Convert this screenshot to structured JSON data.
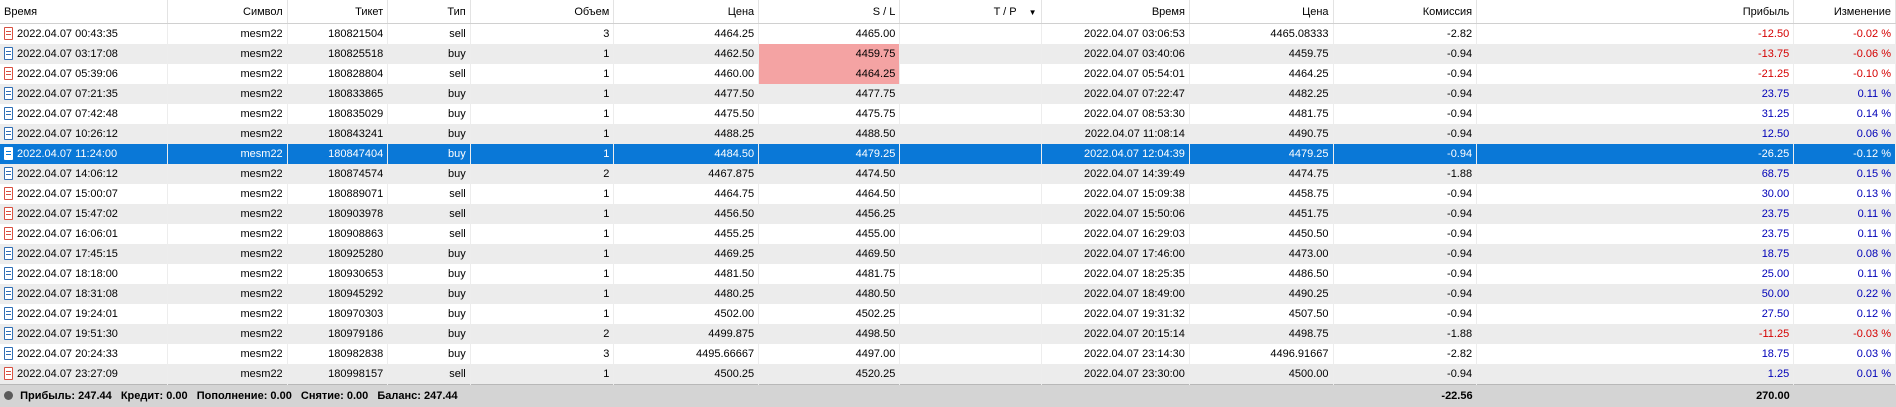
{
  "columns": {
    "time": "Время",
    "symbol": "Символ",
    "ticket": "Тикет",
    "type": "Тип",
    "volume": "Объем",
    "price": "Цена",
    "sl": "S / L",
    "tp": "T / P",
    "close_time": "Время",
    "close_price": "Цена",
    "commission": "Комиссия",
    "profit": "Прибыль",
    "change": "Изменение"
  },
  "sort_arrow": "▼",
  "rows": [
    {
      "time": "2022.04.07 00:43:35",
      "symbol": "mesm22",
      "ticket": "180821504",
      "type": "sell",
      "volume": "3",
      "price": "4464.25",
      "sl": "4465.00",
      "tp": "",
      "close_time": "2022.04.07 03:06:53",
      "close_price": "4465.08333",
      "commission": "-2.82",
      "profit": "-12.50",
      "change": "-0.02 %"
    },
    {
      "time": "2022.04.07 03:17:08",
      "symbol": "mesm22",
      "ticket": "180825518",
      "type": "buy",
      "volume": "1",
      "price": "4462.50",
      "sl": "4459.75",
      "tp": "",
      "close_time": "2022.04.07 03:40:06",
      "close_price": "4459.75",
      "commission": "-0.94",
      "profit": "-13.75",
      "change": "-0.06 %"
    },
    {
      "time": "2022.04.07 05:39:06",
      "symbol": "mesm22",
      "ticket": "180828804",
      "type": "sell",
      "volume": "1",
      "price": "4460.00",
      "sl": "4464.25",
      "tp": "",
      "close_time": "2022.04.07 05:54:01",
      "close_price": "4464.25",
      "commission": "-0.94",
      "profit": "-21.25",
      "change": "-0.10 %"
    },
    {
      "time": "2022.04.07 07:21:35",
      "symbol": "mesm22",
      "ticket": "180833865",
      "type": "buy",
      "volume": "1",
      "price": "4477.50",
      "sl": "4477.75",
      "tp": "",
      "close_time": "2022.04.07 07:22:47",
      "close_price": "4482.25",
      "commission": "-0.94",
      "profit": "23.75",
      "change": "0.11 %"
    },
    {
      "time": "2022.04.07 07:42:48",
      "symbol": "mesm22",
      "ticket": "180835029",
      "type": "buy",
      "volume": "1",
      "price": "4475.50",
      "sl": "4475.75",
      "tp": "",
      "close_time": "2022.04.07 08:53:30",
      "close_price": "4481.75",
      "commission": "-0.94",
      "profit": "31.25",
      "change": "0.14 %"
    },
    {
      "time": "2022.04.07 10:26:12",
      "symbol": "mesm22",
      "ticket": "180843241",
      "type": "buy",
      "volume": "1",
      "price": "4488.25",
      "sl": "4488.50",
      "tp": "",
      "close_time": "2022.04.07 11:08:14",
      "close_price": "4490.75",
      "commission": "-0.94",
      "profit": "12.50",
      "change": "0.06 %"
    },
    {
      "time": "2022.04.07 11:24:00",
      "symbol": "mesm22",
      "ticket": "180847404",
      "type": "buy",
      "volume": "1",
      "price": "4484.50",
      "sl": "4479.25",
      "tp": "",
      "close_time": "2022.04.07 12:04:39",
      "close_price": "4479.25",
      "commission": "-0.94",
      "profit": "-26.25",
      "change": "-0.12 %"
    },
    {
      "time": "2022.04.07 14:06:12",
      "symbol": "mesm22",
      "ticket": "180874574",
      "type": "buy",
      "volume": "2",
      "price": "4467.875",
      "sl": "4474.50",
      "tp": "",
      "close_time": "2022.04.07 14:39:49",
      "close_price": "4474.75",
      "commission": "-1.88",
      "profit": "68.75",
      "change": "0.15 %"
    },
    {
      "time": "2022.04.07 15:00:07",
      "symbol": "mesm22",
      "ticket": "180889071",
      "type": "sell",
      "volume": "1",
      "price": "4464.75",
      "sl": "4464.50",
      "tp": "",
      "close_time": "2022.04.07 15:09:38",
      "close_price": "4458.75",
      "commission": "-0.94",
      "profit": "30.00",
      "change": "0.13 %"
    },
    {
      "time": "2022.04.07 15:47:02",
      "symbol": "mesm22",
      "ticket": "180903978",
      "type": "sell",
      "volume": "1",
      "price": "4456.50",
      "sl": "4456.25",
      "tp": "",
      "close_time": "2022.04.07 15:50:06",
      "close_price": "4451.75",
      "commission": "-0.94",
      "profit": "23.75",
      "change": "0.11 %"
    },
    {
      "time": "2022.04.07 16:06:01",
      "symbol": "mesm22",
      "ticket": "180908863",
      "type": "sell",
      "volume": "1",
      "price": "4455.25",
      "sl": "4455.00",
      "tp": "",
      "close_time": "2022.04.07 16:29:03",
      "close_price": "4450.50",
      "commission": "-0.94",
      "profit": "23.75",
      "change": "0.11 %"
    },
    {
      "time": "2022.04.07 17:45:15",
      "symbol": "mesm22",
      "ticket": "180925280",
      "type": "buy",
      "volume": "1",
      "price": "4469.25",
      "sl": "4469.50",
      "tp": "",
      "close_time": "2022.04.07 17:46:00",
      "close_price": "4473.00",
      "commission": "-0.94",
      "profit": "18.75",
      "change": "0.08 %"
    },
    {
      "time": "2022.04.07 18:18:00",
      "symbol": "mesm22",
      "ticket": "180930653",
      "type": "buy",
      "volume": "1",
      "price": "4481.50",
      "sl": "4481.75",
      "tp": "",
      "close_time": "2022.04.07 18:25:35",
      "close_price": "4486.50",
      "commission": "-0.94",
      "profit": "25.00",
      "change": "0.11 %"
    },
    {
      "time": "2022.04.07 18:31:08",
      "symbol": "mesm22",
      "ticket": "180945292",
      "type": "buy",
      "volume": "1",
      "price": "4480.25",
      "sl": "4480.50",
      "tp": "",
      "close_time": "2022.04.07 18:49:00",
      "close_price": "4490.25",
      "commission": "-0.94",
      "profit": "50.00",
      "change": "0.22 %"
    },
    {
      "time": "2022.04.07 19:24:01",
      "symbol": "mesm22",
      "ticket": "180970303",
      "type": "buy",
      "volume": "1",
      "price": "4502.00",
      "sl": "4502.25",
      "tp": "",
      "close_time": "2022.04.07 19:31:32",
      "close_price": "4507.50",
      "commission": "-0.94",
      "profit": "27.50",
      "change": "0.12 %"
    },
    {
      "time": "2022.04.07 19:51:30",
      "symbol": "mesm22",
      "ticket": "180979186",
      "type": "buy",
      "volume": "2",
      "price": "4499.875",
      "sl": "4498.50",
      "tp": "",
      "close_time": "2022.04.07 20:15:14",
      "close_price": "4498.75",
      "commission": "-1.88",
      "profit": "-11.25",
      "change": "-0.03 %"
    },
    {
      "time": "2022.04.07 20:24:33",
      "symbol": "mesm22",
      "ticket": "180982838",
      "type": "buy",
      "volume": "3",
      "price": "4495.66667",
      "sl": "4497.00",
      "tp": "",
      "close_time": "2022.04.07 23:14:30",
      "close_price": "4496.91667",
      "commission": "-2.82",
      "profit": "18.75",
      "change": "0.03 %"
    },
    {
      "time": "2022.04.07 23:27:09",
      "symbol": "mesm22",
      "ticket": "180998157",
      "type": "sell",
      "volume": "1",
      "price": "4500.25",
      "sl": "4520.25",
      "tp": "",
      "close_time": "2022.04.07 23:30:00",
      "close_price": "4500.00",
      "commission": "-0.94",
      "profit": "1.25",
      "change": "0.01 %"
    }
  ],
  "highlighted_sl_rows": [
    1,
    2
  ],
  "selected_row": 6,
  "summary": {
    "profit": "Прибыль: 247.44",
    "credit": "Кредит: 0.00",
    "deposit": "Пополнение: 0.00",
    "withdrawal": "Снятие: 0.00",
    "balance": "Баланс: 247.44",
    "commission_total": "-22.56",
    "profit_total": "270.00"
  },
  "colors": {
    "selected": "#0a78d7",
    "sl_highlight": "#f4a3a3",
    "negative": "#d40000",
    "positive": "#0000b8"
  }
}
